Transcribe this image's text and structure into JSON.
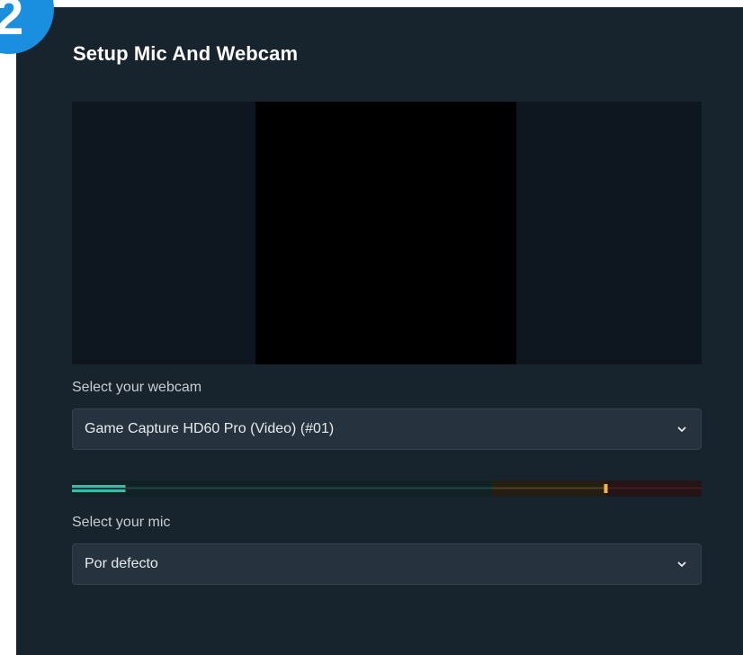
{
  "badge": {
    "text": "2",
    "color": "#1a8fe0"
  },
  "panel": {
    "title": "Setup Mic And Webcam",
    "background": "#17232d"
  },
  "webcam": {
    "label": "Select your webcam",
    "selected": "Game Capture HD60 Pro (Video) (#01)"
  },
  "mic": {
    "label": "Select your mic",
    "selected": "Por defecto",
    "level": 0.085,
    "peak": 0.845,
    "meter_colors": {
      "low": "#3fb9a6",
      "mid": "#e3a63a",
      "high": "#a8322e"
    }
  },
  "icons": {
    "dropdown": "chevron-down-icon"
  }
}
